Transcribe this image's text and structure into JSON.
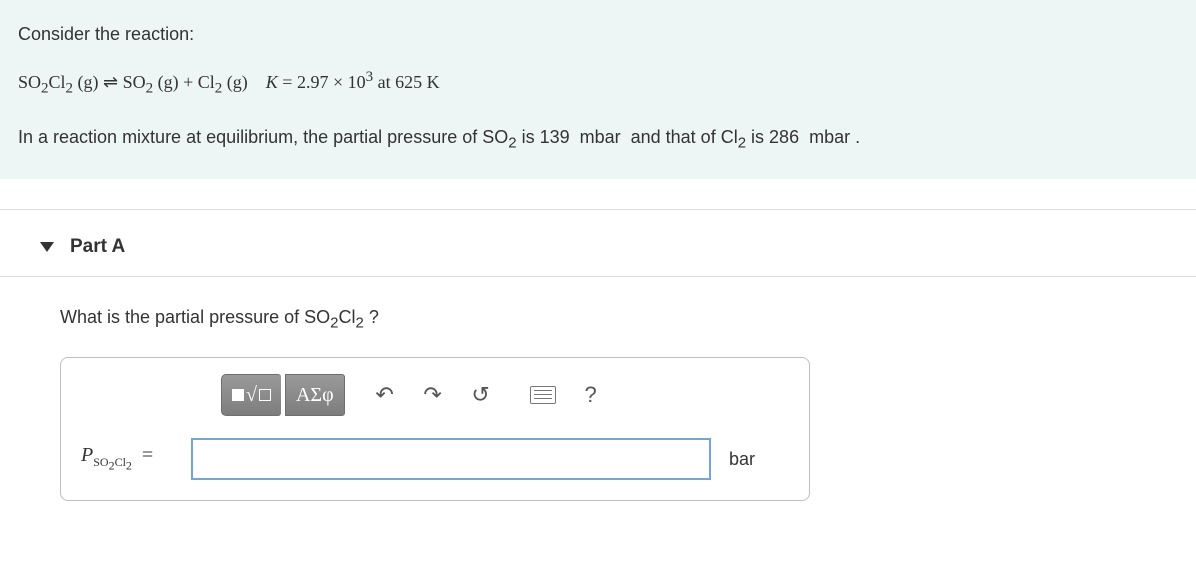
{
  "problem": {
    "intro": "Consider the reaction:",
    "equation_html": "SO<sub>2</sub>Cl<sub>2</sub> (g) ⇌ SO<sub>2</sub> (g) + Cl<sub>2</sub> (g) &nbsp;&nbsp; <i>K</i> = 2.97 × 10<sup>3</sup> at 625 K",
    "context_html": "In a reaction mixture at equilibrium, the partial pressure of SO<sub>2</sub> is 139&nbsp; mbar&nbsp; and that of Cl<sub>2</sub> is 286&nbsp; mbar ."
  },
  "part": {
    "label": "Part A",
    "question_html": "What is the partial pressure of SO<sub>2</sub>Cl<sub>2</sub> ?",
    "variable_html": "P<sub>SO<sub>2</sub>Cl<sub>2</sub></sub>",
    "equals": "=",
    "unit": "bar",
    "input_value": ""
  },
  "toolbar": {
    "templates_label": "▮√▫",
    "symbols_label": "ΑΣφ",
    "undo": "↶",
    "redo": "↷",
    "reset": "↺",
    "keyboard": "keyboard",
    "help": "?"
  }
}
